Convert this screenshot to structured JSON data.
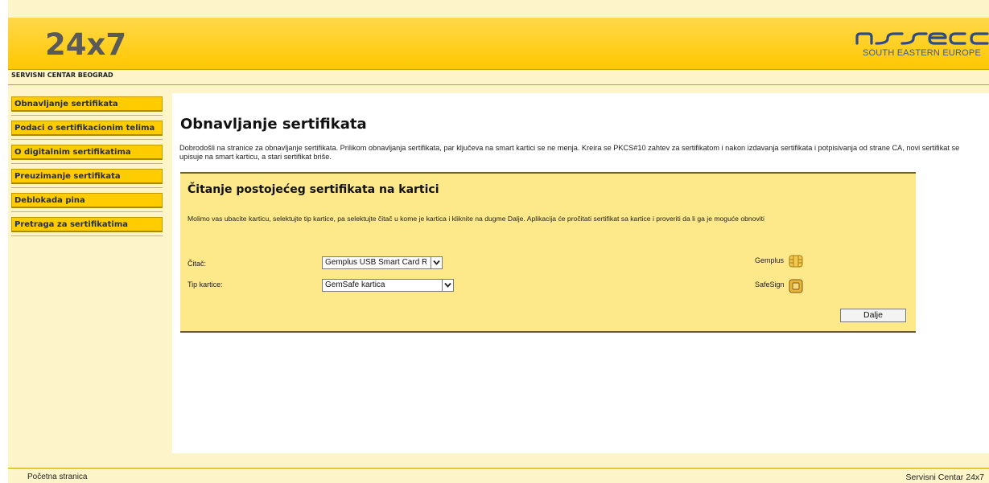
{
  "header": {
    "logo_text": "24x7",
    "brand_name": "asseco",
    "brand_sub": "SOUTH EASTERN EUROPE",
    "subtitle": "SERVISNI CENTAR BEOGRAD"
  },
  "sidebar": {
    "items": [
      {
        "label": "Obnavljanje sertifikata"
      },
      {
        "label": "Podaci o sertifikacionim telima"
      },
      {
        "label": "O digitalnim sertifikatima"
      },
      {
        "label": "Preuzimanje sertifikata"
      },
      {
        "label": "Deblokada pina"
      },
      {
        "label": "Pretraga za sertifikatima"
      }
    ]
  },
  "main": {
    "title": "Obnavljanje sertifikata",
    "intro": "Dobrodošli na stranice za obnavljanje sertifikata. Prilikom obnavljanja sertifikata, par ključeva na smart kartici se ne menja. Kreira se PKCS#10 zahtev za sertifikatom i nakon izdavanja sertifikata i potpisivanja od strane CA, novi sertifikat se upisuje na smart karticu, a stari sertifikat briše.",
    "box": {
      "title": "Čitanje postojećeg sertifikata na kartici",
      "text": "Molimo vas ubacite karticu, selektujte tip kartice, pa selektujte čitač u kome je kartica i kliknite na dugme Dalje. Aplikacija će pročitati sertifikat sa kartice i proveriti da li ga je moguće obnoviti",
      "reader_label": "Čitač:",
      "reader_value": "Gemplus USB Smart Card Reader",
      "card_type_label": "Tip kartice:",
      "card_type_value": "GemSafe kartica",
      "card_gemplus": "Gemplus",
      "card_safesign": "SafeSign",
      "next_button": "Dalje"
    }
  },
  "footer": {
    "left": "Početna stranica",
    "right": "Servisni Centar 24x7"
  },
  "colors": {
    "header_yellow": "#ffc800",
    "nav_yellow": "#ffcc00",
    "panel_yellow": "#fee98a",
    "page_bg": "#fdf5c9",
    "nav_text": "#1f2d66",
    "brand_blue": "#3a5998"
  },
  "icons": [
    "gemplus-chip-icon",
    "safesign-chip-icon",
    "chevron-down-icon"
  ]
}
